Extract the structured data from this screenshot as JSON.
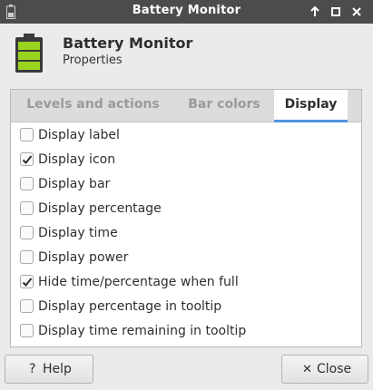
{
  "window": {
    "title": "Battery Monitor"
  },
  "header": {
    "title": "Battery Monitor",
    "subtitle": "Properties"
  },
  "tabs": [
    {
      "label": "Levels and actions",
      "active": false
    },
    {
      "label": "Bar colors",
      "active": false
    },
    {
      "label": "Display",
      "active": true
    }
  ],
  "options": [
    {
      "label": "Display label",
      "checked": false
    },
    {
      "label": "Display icon",
      "checked": true
    },
    {
      "label": "Display bar",
      "checked": false
    },
    {
      "label": "Display percentage",
      "checked": false
    },
    {
      "label": "Display time",
      "checked": false
    },
    {
      "label": "Display power",
      "checked": false
    },
    {
      "label": "Hide time/percentage when full",
      "checked": true
    },
    {
      "label": "Display percentage in tooltip",
      "checked": false
    },
    {
      "label": "Display time remaining in tooltip",
      "checked": false
    }
  ],
  "buttons": {
    "help_label": "Help",
    "help_glyph": "?",
    "close_label": "Close",
    "close_glyph": "✕"
  },
  "colors": {
    "titlebar": "#4c4c4c",
    "accent": "#5294e2",
    "battery_green": "#9bd41f"
  },
  "icons": {
    "app": "battery-icon",
    "header": "battery-icon",
    "window_controls": [
      "maximize-up-icon",
      "restore-icon",
      "close-icon"
    ]
  }
}
